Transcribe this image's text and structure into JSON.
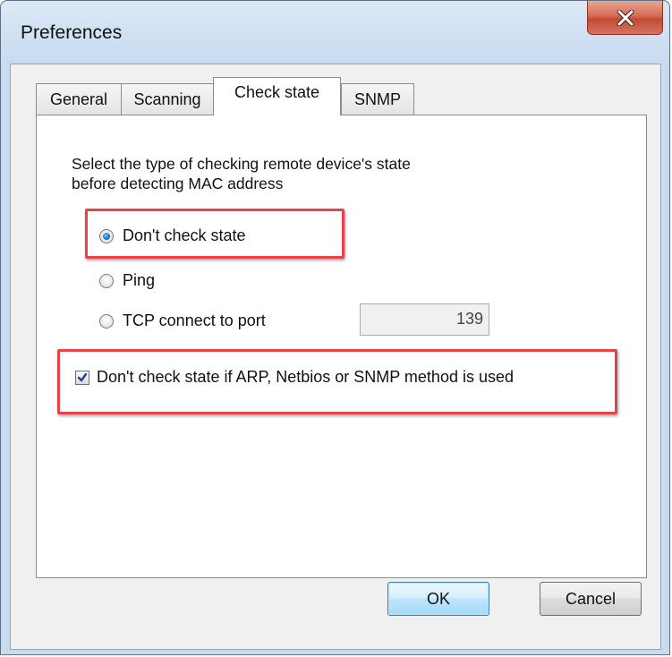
{
  "window": {
    "title": "Preferences",
    "close_icon": "close-icon"
  },
  "tabs": [
    {
      "label": "General",
      "active": false
    },
    {
      "label": "Scanning",
      "active": false
    },
    {
      "label": "Check state",
      "active": true
    },
    {
      "label": "SNMP",
      "active": false
    }
  ],
  "check_state": {
    "description_line1": "Select the type of checking remote device's state",
    "description_line2": "before detecting MAC address",
    "options": [
      {
        "label": "Don't check state",
        "selected": true
      },
      {
        "label": "Ping",
        "selected": false
      },
      {
        "label": "TCP connect to port",
        "selected": false
      }
    ],
    "port_value": "139",
    "skip_checkbox_label": "Don't check state if ARP, Netbios or SNMP method is used",
    "skip_checkbox_checked": true
  },
  "buttons": {
    "ok_label": "OK",
    "cancel_label": "Cancel"
  },
  "colors": {
    "highlight": "#e8434a",
    "radio_selected": "#1f6fc6"
  }
}
